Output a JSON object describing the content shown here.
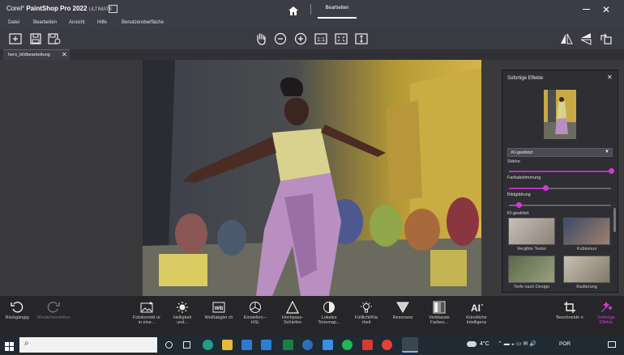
{
  "app": {
    "title_brand": "Corel",
    "title_product": "PaintShop Pro 2022",
    "title_edition": "ULTIMATE",
    "home_tab": "Bearbeiten"
  },
  "menu": [
    "Datei",
    "Bearbeiten",
    "Ansicht",
    "Hilfe",
    "Benutzeroberfläche"
  ],
  "document_tab": "hero_bildbearbeitung",
  "panel": {
    "title": "Sofortige Effekte",
    "dropdown_value": "KI-gestützt",
    "sliders": [
      {
        "label": "Stärke",
        "value": 1.0
      },
      {
        "label": "Farbabstimmung",
        "value": 0.36
      },
      {
        "label": "Bildglättung",
        "value": 0.1
      }
    ],
    "category_label": "KI-gestützt",
    "thumbnails": [
      "Vergibte Textur",
      "Kubismus",
      "Tiefe nach Design",
      "Radierung"
    ]
  },
  "bottom_left": {
    "undo": "Rückgängig",
    "redo": "Wiederherstellen"
  },
  "bottom_tools": [
    {
      "name": "fotokorrektur",
      "label": "Fotokorrekt ur in eine..."
    },
    {
      "name": "helligkeit",
      "label": "Helligkeit und..."
    },
    {
      "name": "weissabgleich",
      "label": "Weißabglei ch"
    },
    {
      "name": "einstellen-hsl",
      "label": "Einstellen – HSL"
    },
    {
      "name": "hochpass",
      "label": "Hochpass-Schärfen"
    },
    {
      "name": "tonemap",
      "label": "Lokales Tonemap..."
    },
    {
      "name": "fuelllicht",
      "label": "Fülllicht/Kla rheit"
    },
    {
      "name": "resonanz",
      "label": "Resonanz"
    },
    {
      "name": "verblasste",
      "label": "Verblasste Farben..."
    },
    {
      "name": "ki",
      "label": "Künstliche Intelligenz"
    }
  ],
  "bottom_right": {
    "crop": "Beschneide n",
    "effects": "Sofortige Effekte"
  },
  "taskbar": {
    "weather": "4°C",
    "language": "POR"
  }
}
